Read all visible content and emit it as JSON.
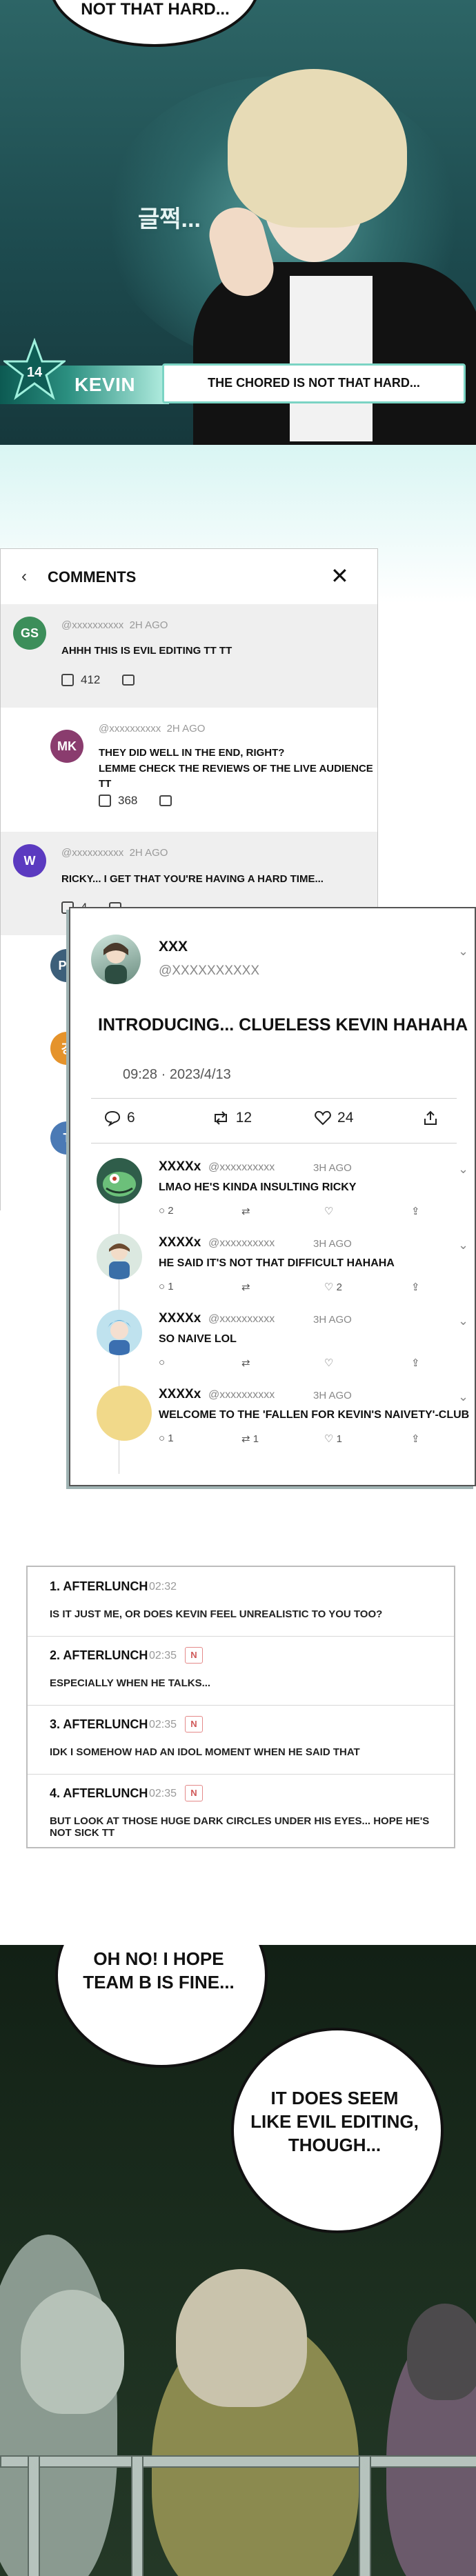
{
  "panel1": {
    "speech_top": "NOT THAT HARD...",
    "background_text": "글쩍...",
    "caption_badge": "14",
    "caption_name": "KEVIN",
    "caption_quote": "THE CHORED IS NOT THAT HARD..."
  },
  "comments": {
    "title": "COMMENTS",
    "back_icon": "chevron-left-icon",
    "close_icon": "close-icon",
    "items": [
      {
        "initials": "GS",
        "color": "#3c8e5a",
        "handle": "@xxxxxxxxxx",
        "time": "2H AGO",
        "text": "AHHH THIS IS EVIL EDITING TT TT",
        "likes": "412"
      },
      {
        "initials": "MK",
        "color": "#8a3c6e",
        "handle": "@xxxxxxxxxx",
        "time": "2H AGO",
        "text1": "THEY DID WELL IN THE END, RIGHT?",
        "text2": "LEMME CHECK THE REVIEWS OF THE LIVE AUDIENCE TT",
        "likes": "368"
      },
      {
        "initials": "W",
        "color": "#5b3ac0",
        "handle": "@xxxxxxxxxx",
        "time": "2H AGO",
        "text": "RICKY... I GET THAT YOU'RE HAVING A HARD TIME...",
        "likes": "4"
      },
      {
        "initials": "PC",
        "color": "#3d5f7a"
      },
      {
        "initials": "강",
        "color": "#e5932b"
      },
      {
        "initials": "T",
        "color": "#4b7ab5"
      }
    ]
  },
  "tweet": {
    "name": "XXX",
    "handle": "@XXXXXXXXXX",
    "body": "INTRODUCING... CLUELESS KEVIN HAHAHA",
    "datetime": "09:28 · 2023/4/13",
    "replies": "6",
    "retweets": "12",
    "likes": "24",
    "reply_list": [
      {
        "name": "XXXXx",
        "handle": "@xxxxxxxxxx",
        "time": "3H AGO",
        "text": "LMAO HE'S KINDA INSULTING RICKY",
        "c": "2",
        "r": "",
        "l": ""
      },
      {
        "name": "XXXXx",
        "handle": "@xxxxxxxxxx",
        "time": "3H AGO",
        "text": "HE SAID IT'S NOT THAT DIFFICULT HAHAHA",
        "c": "1",
        "r": "",
        "l": "2"
      },
      {
        "name": "XXXXx",
        "handle": "@xxxxxxxxxx",
        "time": "3H AGO",
        "text": "SO NAIVE LOL",
        "c": "",
        "r": "",
        "l": ""
      },
      {
        "name": "XXXXx",
        "handle": "@xxxxxxxxxx",
        "time": "3H AGO",
        "text": "WELCOME TO THE 'FALLEN FOR KEVIN'S NAIVETY'-CLUB",
        "c": "1",
        "r": "1",
        "l": "1"
      }
    ]
  },
  "forum": {
    "rows": [
      {
        "user": "1. AFTERLUNCH",
        "time": "02:32",
        "badge": "",
        "text": "IS IT JUST ME, OR DOES KEVIN FEEL UNREALISTIC TO YOU TOO?"
      },
      {
        "user": "2. AFTERLUNCH",
        "time": "02:35",
        "badge": "N",
        "text": "ESPECIALLY WHEN HE TALKS..."
      },
      {
        "user": "3. AFTERLUNCH",
        "time": "02:35",
        "badge": "N",
        "text": "IDK I SOMEHOW HAD AN IDOL MOMENT WHEN HE SAID THAT"
      },
      {
        "user": "4. AFTERLUNCH",
        "time": "02:35",
        "badge": "N",
        "text": "BUT LOOK AT THOSE HUGE DARK CIRCLES UNDER HIS EYES... HOPE HE'S NOT SICK TT"
      }
    ]
  },
  "scene": {
    "bubble1_line1": "OH NO! I HOPE",
    "bubble1_line2": "TEAM B IS FINE...",
    "bubble2_line1": "IT DOES SEEM",
    "bubble2_line2": "LIKE EVIL EDITING,",
    "bubble2_line3": "THOUGH..."
  }
}
